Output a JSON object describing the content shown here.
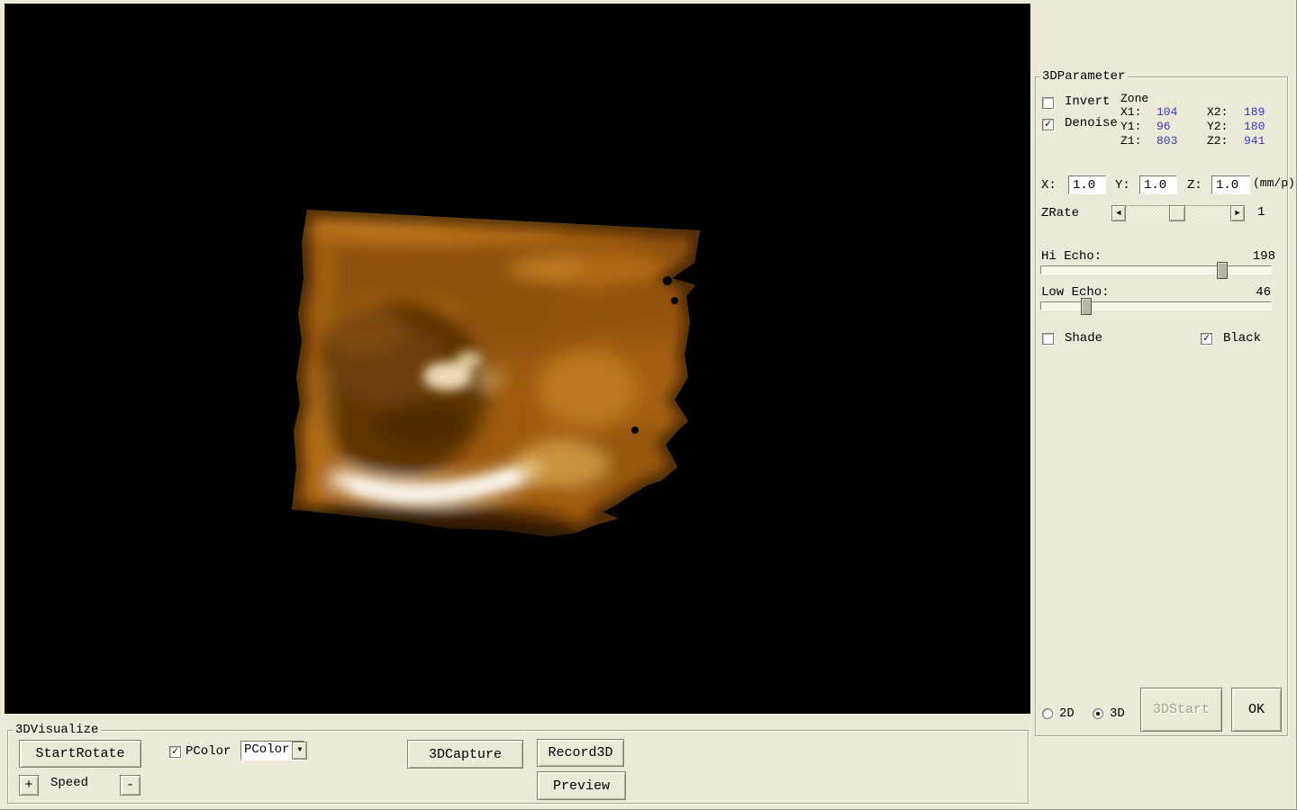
{
  "viewport": {
    "description": "3D ultrasound volume rendering of fetal face"
  },
  "parameter_panel": {
    "title": "3DParameter",
    "invert": {
      "label": "Invert",
      "checked": false,
      "mark": ""
    },
    "denoise": {
      "label": "Denoise",
      "checked": true,
      "mark": "✓"
    },
    "zone": {
      "label": "Zone",
      "x1_label": "X1:",
      "x1": "104",
      "x2_label": "X2:",
      "x2": "189",
      "y1_label": "Y1:",
      "y1": "96",
      "y2_label": "Y2:",
      "y2": "180",
      "z1_label": "Z1:",
      "z1": "803",
      "z2_label": "Z2:",
      "z2": "941",
      "value_color": "#3939c0"
    },
    "scale": {
      "x_label": "X:",
      "x_value": "1.0",
      "y_label": "Y:",
      "y_value": "1.0",
      "z_label": "Z:",
      "z_value": "1.0",
      "unit": "(mm/p)"
    },
    "zrate": {
      "label": "ZRate",
      "value": "1",
      "left_arrow": "◄",
      "right_arrow": "►"
    },
    "hi_echo": {
      "label": "Hi Echo:",
      "value": "198"
    },
    "low_echo": {
      "label": "Low Echo:",
      "value": "46"
    },
    "shade": {
      "label": "Shade",
      "checked": false,
      "mark": ""
    },
    "black": {
      "label": "Black",
      "checked": true,
      "mark": "✓"
    },
    "mode_2d": {
      "label": "2D",
      "selected": false
    },
    "mode_3d": {
      "label": "3D",
      "selected": true
    },
    "start_button_label": "3DStart",
    "ok_button_label": "OK"
  },
  "visualize_panel": {
    "title": "3DVisualize",
    "start_rotate_button": "StartRotate",
    "speed_plus": "+",
    "speed_label": "Speed",
    "speed_minus": "-",
    "pcolor_checkbox": {
      "label": "PColor",
      "checked": true,
      "mark": "✓"
    },
    "pcolor_dropdown": {
      "value": "PColor",
      "arrow": "▼"
    },
    "capture_button": "3DCapture",
    "record_button": "Record3D",
    "preview_button": "Preview"
  }
}
